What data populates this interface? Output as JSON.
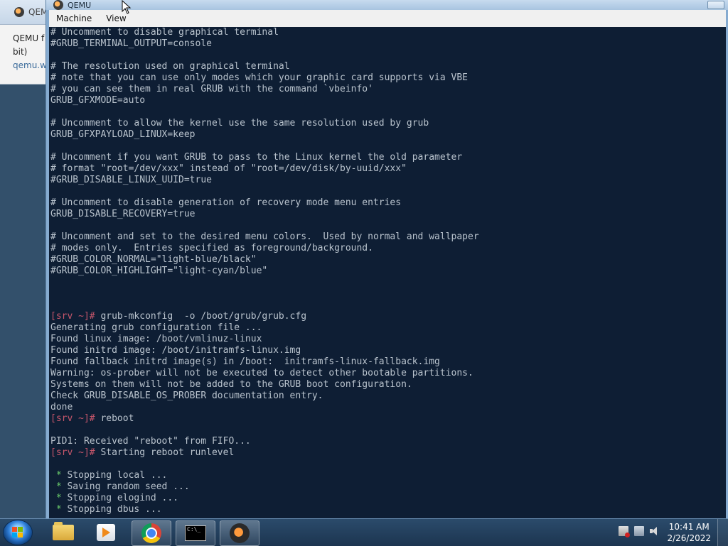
{
  "background_window": {
    "tab_title": "QEM",
    "lines": [
      "QEMU f",
      "bit)",
      "qemu.w"
    ]
  },
  "qemu": {
    "title": "QEMU",
    "menu": [
      "Machine",
      "View"
    ]
  },
  "terminal": {
    "lines": [
      {
        "t": "# Uncomment to disable graphical terminal"
      },
      {
        "t": "#GRUB_TERMINAL_OUTPUT=console"
      },
      {
        "t": ""
      },
      {
        "t": "# The resolution used on graphical terminal"
      },
      {
        "t": "# note that you can use only modes which your graphic card supports via VBE"
      },
      {
        "t": "# you can see them in real GRUB with the command `vbeinfo'"
      },
      {
        "t": "GRUB_GFXMODE=auto"
      },
      {
        "t": ""
      },
      {
        "t": "# Uncomment to allow the kernel use the same resolution used by grub"
      },
      {
        "t": "GRUB_GFXPAYLOAD_LINUX=keep"
      },
      {
        "t": ""
      },
      {
        "t": "# Uncomment if you want GRUB to pass to the Linux kernel the old parameter"
      },
      {
        "t": "# format \"root=/dev/xxx\" instead of \"root=/dev/disk/by-uuid/xxx\""
      },
      {
        "t": "#GRUB_DISABLE_LINUX_UUID=true"
      },
      {
        "t": ""
      },
      {
        "t": "# Uncomment to disable generation of recovery mode menu entries"
      },
      {
        "t": "GRUB_DISABLE_RECOVERY=true"
      },
      {
        "t": ""
      },
      {
        "t": "# Uncomment and set to the desired menu colors.  Used by normal and wallpaper"
      },
      {
        "t": "# modes only.  Entries specified as foreground/background."
      },
      {
        "t": "#GRUB_COLOR_NORMAL=\"light-blue/black\""
      },
      {
        "t": "#GRUB_COLOR_HIGHLIGHT=\"light-cyan/blue\""
      },
      {
        "t": ""
      },
      {
        "t": ""
      },
      {
        "t": ""
      },
      {
        "p": "[srv ~]#",
        "t": " grub-mkconfig  -o /boot/grub/grub.cfg"
      },
      {
        "t": "Generating grub configuration file ..."
      },
      {
        "t": "Found linux image: /boot/vmlinuz-linux"
      },
      {
        "t": "Found initrd image: /boot/initramfs-linux.img"
      },
      {
        "t": "Found fallback initrd image(s) in /boot:  initramfs-linux-fallback.img"
      },
      {
        "t": "Warning: os-prober will not be executed to detect other bootable partitions."
      },
      {
        "t": "Systems on them will not be added to the GRUB boot configuration."
      },
      {
        "t": "Check GRUB_DISABLE_OS_PROBER documentation entry."
      },
      {
        "t": "done"
      },
      {
        "p": "[srv ~]#",
        "t": " reboot"
      },
      {
        "t": ""
      },
      {
        "t": "PID1: Received \"reboot\" from FIFO..."
      },
      {
        "p": "[srv ~]#",
        "t": " Starting reboot runlevel"
      },
      {
        "t": ""
      },
      {
        "s": " *",
        "t": " Stopping local ..."
      },
      {
        "s": " *",
        "t": " Saving random seed ..."
      },
      {
        "s": " *",
        "t": " Stopping elogind ..."
      },
      {
        "s": " *",
        "t": " Stopping dbus ..."
      }
    ]
  },
  "taskbar": {
    "apps": [
      "start-orb",
      "file-explorer",
      "media-player",
      "chrome",
      "command-prompt",
      "qemu"
    ],
    "cmd_icon_text": "C:\\_",
    "clock": {
      "time": "10:41 AM",
      "date": "2/26/2022"
    }
  },
  "colors": {
    "terminal_bg": "#0e1e34",
    "terminal_fg": "#b9c3cd",
    "prompt": "#c6566b",
    "star": "#6ccf6c"
  }
}
